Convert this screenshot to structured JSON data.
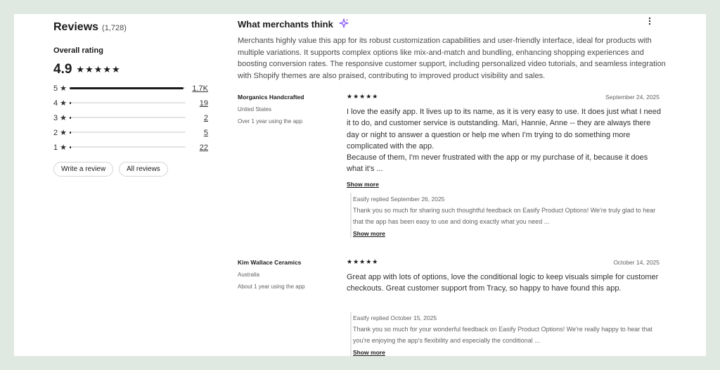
{
  "summary_panel": {
    "title": "Reviews",
    "count": "(1,728)",
    "overall_label": "Overall rating",
    "score": "4.9",
    "score_stars": "★★★★★",
    "distribution": [
      {
        "label": "5 ★",
        "count": "1.7K",
        "fraction": 0.98
      },
      {
        "label": "4 ★",
        "count": "19",
        "fraction": 0.011
      },
      {
        "label": "3 ★",
        "count": "2",
        "fraction": 0.002
      },
      {
        "label": "2 ★",
        "count": "5",
        "fraction": 0.003
      },
      {
        "label": "1 ★",
        "count": "22",
        "fraction": 0.013
      }
    ],
    "write_review_label": "Write a review",
    "all_reviews_label": "All reviews"
  },
  "merchants": {
    "title": "What merchants think",
    "sparkle_icon": "sparkle-icon",
    "summary": "Merchants highly value this app for its robust customization capabilities and user-friendly interface, ideal for products with multiple variations. It supports complex options like mix-and-match and bundling, enhancing shopping experiences and boosting conversion rates. The responsive customer support, including personalized video tutorials, and seamless integration with Shopify themes are also praised, contributing to improved product visibility and sales."
  },
  "reviews": [
    {
      "author": "Morganics Handcrafted",
      "location": "United States",
      "usage": "Over 1 year using the app",
      "stars": "★★★★★",
      "date": "September 24, 2025",
      "body": "I love the easify app. It lives up to its name, as it is very easy to use. It does just what I need it to do, and customer service is outstanding. Mari, Hannie, Anne -- they are always there day or night to answer a question or help me when I'm trying to do something more complicated with the app.\nBecause of them, I'm never frustrated with the app or my purchase of it, because it does what it's ...",
      "show_more": "Show more",
      "reply_header": "Easify replied September 26, 2025",
      "reply_body": "Thank you so much for sharing such thoughtful feedback on Easify Product Options! We're truly glad to hear that the app has been easy to use and doing exactly what you need ...",
      "reply_show_more": "Show more"
    },
    {
      "author": "Kim Wallace Ceramics",
      "location": "Australia",
      "usage": "About 1 year using the app",
      "stars": "★★★★★",
      "date": "October 14, 2025",
      "body": "Great app with lots of options, love the conditional logic to keep visuals simple for customer checkouts. Great customer support from Tracy, so happy to have found this app.",
      "reply_header": "Easify replied October 15, 2025",
      "reply_body": "Thank you so much for your wonderful feedback on Easify Product Options! We're really happy to hear that you're enjoying the app's flexibility and especially the conditional ...",
      "reply_show_more": "Show more"
    }
  ],
  "icons": {
    "more": "more-vertical-icon",
    "star": "star-icon"
  }
}
